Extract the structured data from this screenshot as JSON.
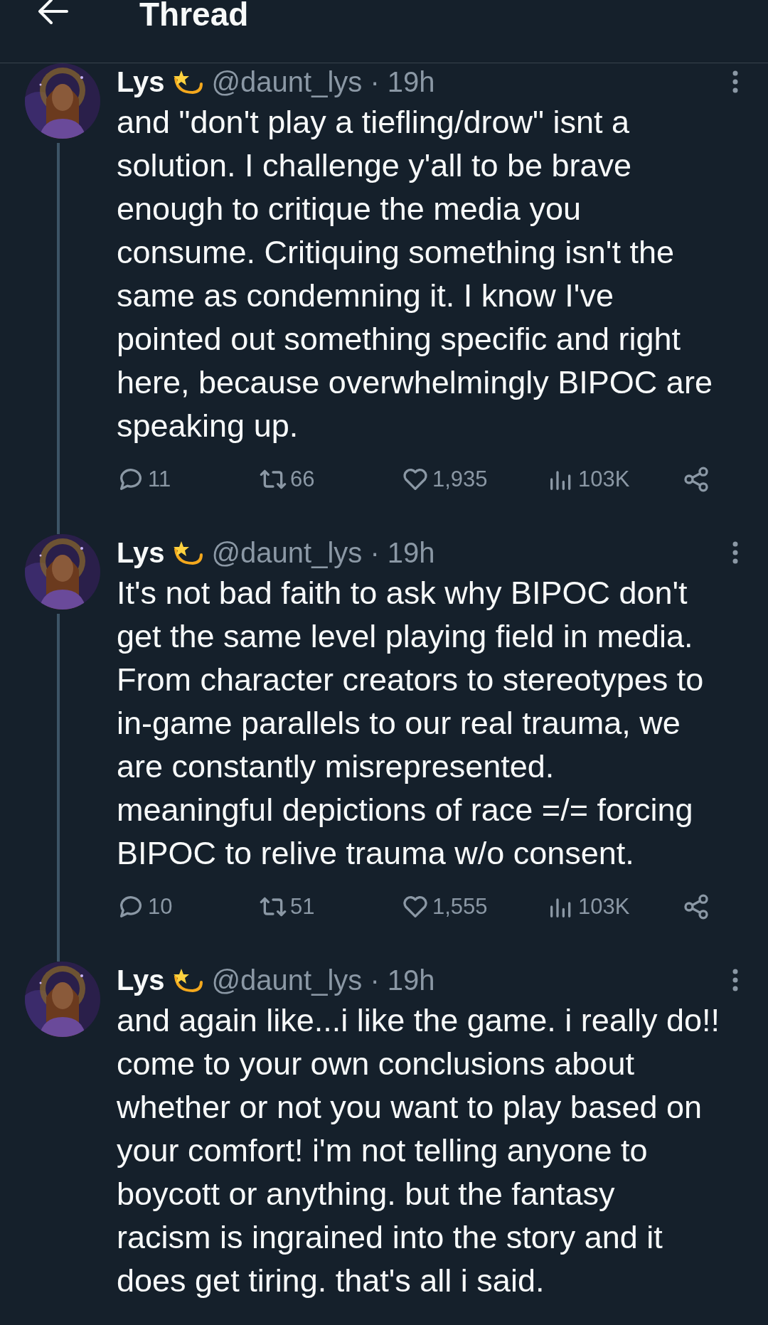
{
  "header": {
    "title": "Thread"
  },
  "posts": [
    {
      "name": "Lys",
      "meta": "@daunt_lys · 19h",
      "lines": [
        "and \"don't play a tiefling/drow\" isnt a",
        "solution. I challenge y'all to be brave",
        "enough to critique the media you",
        "consume. Critiquing something isn't the",
        "same as condemning it. I know I've",
        "pointed out something specific and right",
        "here, because overwhelmingly BIPOC are",
        "speaking up."
      ],
      "replies": "11",
      "reposts": "66",
      "likes": "1,935",
      "views": "103K",
      "thread_line": true
    },
    {
      "name": "Lys",
      "meta": "@daunt_lys · 19h",
      "lines": [
        "It's not bad faith to ask why BIPOC don't",
        "get the same level playing field in media.",
        "From character creators to stereotypes to",
        "in-game parallels to our real trauma, we",
        "are constantly misrepresented.",
        "meaningful depictions of race =/= forcing",
        "BIPOC to relive trauma w/o consent."
      ],
      "replies": "10",
      "reposts": "51",
      "likes": "1,555",
      "views": "103K",
      "thread_line": true
    },
    {
      "name": "Lys",
      "meta": "@daunt_lys · 19h",
      "lines": [
        "and again like...i like the game. i really do!!",
        "come to your own conclusions about",
        "whether or not you want to play based on",
        "your comfort! i'm not telling anyone to",
        "boycott or anything. but the fantasy",
        "racism is ingrained into the story and it",
        "does get tiring. that's all i said."
      ],
      "thread_line": false
    }
  ]
}
